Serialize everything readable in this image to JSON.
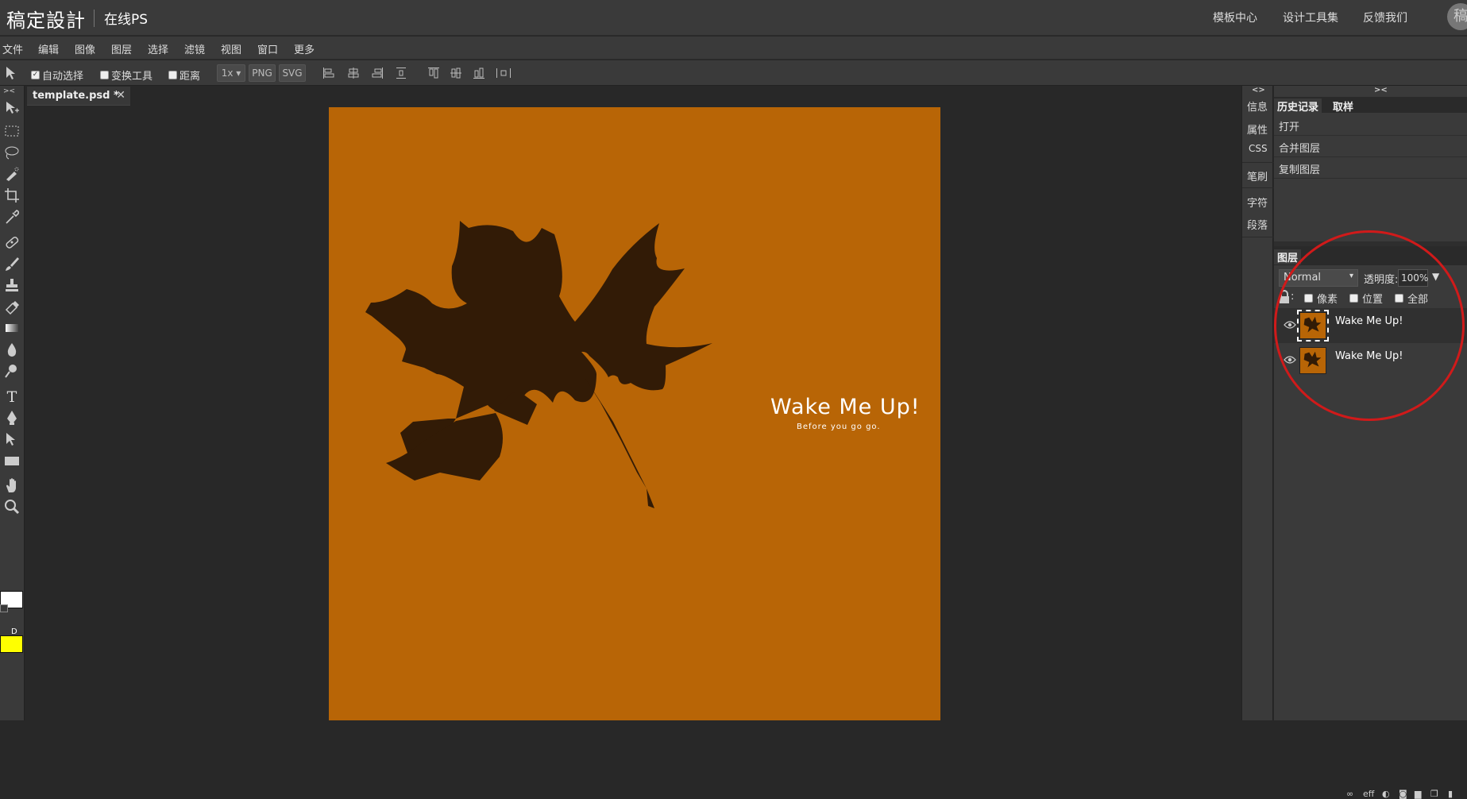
{
  "brand": {
    "name": "稿定設計",
    "sub": "在线PS"
  },
  "toplinks": [
    "模板中心",
    "设计工具集",
    "反馈我们"
  ],
  "avatar_char": "稿",
  "menu": [
    "文件",
    "编辑",
    "图像",
    "图层",
    "选择",
    "滤镜",
    "视图",
    "窗口",
    "更多"
  ],
  "options": {
    "auto_select": {
      "label": "自动选择",
      "checked": true
    },
    "transform": {
      "label": "变换工具",
      "checked": false
    },
    "distance": {
      "label": "距离",
      "checked": false
    },
    "scale": "1x",
    "png": "PNG",
    "svg": "SVG"
  },
  "tools": [
    "move-tool",
    "marquee-tool",
    "lasso-tool",
    "quick-select-tool",
    "crop-tool",
    "eyedropper-tool",
    "healing-tool",
    "brush-tool",
    "stamp-tool",
    "eraser-tool",
    "gradient-tool",
    "blur-tool",
    "dodge-tool",
    "text-tool",
    "pen-tool",
    "path-select-tool",
    "rectangle-tool",
    "hand-tool",
    "zoom-tool"
  ],
  "colors": {
    "foreground": "#ffffff",
    "background": "#ffff00",
    "canvas": "#b86506",
    "leaf": "#321b06",
    "annotation": "#d01a1a"
  },
  "document": {
    "tab": "template.psd *",
    "close": "✕"
  },
  "canvas": {
    "title": "Wake Me Up!",
    "subtitle": "Before you go go."
  },
  "side_strip": {
    "toggle": "<>",
    "items": [
      "信息",
      "属性",
      "CSS",
      "笔刷",
      "字符",
      "段落"
    ]
  },
  "panel": {
    "collapse": "><",
    "tabs": [
      "历史记录",
      "取样"
    ],
    "history": [
      "打开",
      "合并图层",
      "复制图层"
    ],
    "layers_title": "图层",
    "blend_mode": "Normal",
    "opacity_label": "透明度:",
    "opacity_value": "100%",
    "lock_label": ":",
    "lock_options": [
      "像素",
      "位置",
      "全部"
    ],
    "layers": [
      {
        "name": "Wake Me Up!",
        "selected": true
      },
      {
        "name": "Wake Me Up!",
        "selected": false
      }
    ],
    "footer_fx": "eff"
  }
}
